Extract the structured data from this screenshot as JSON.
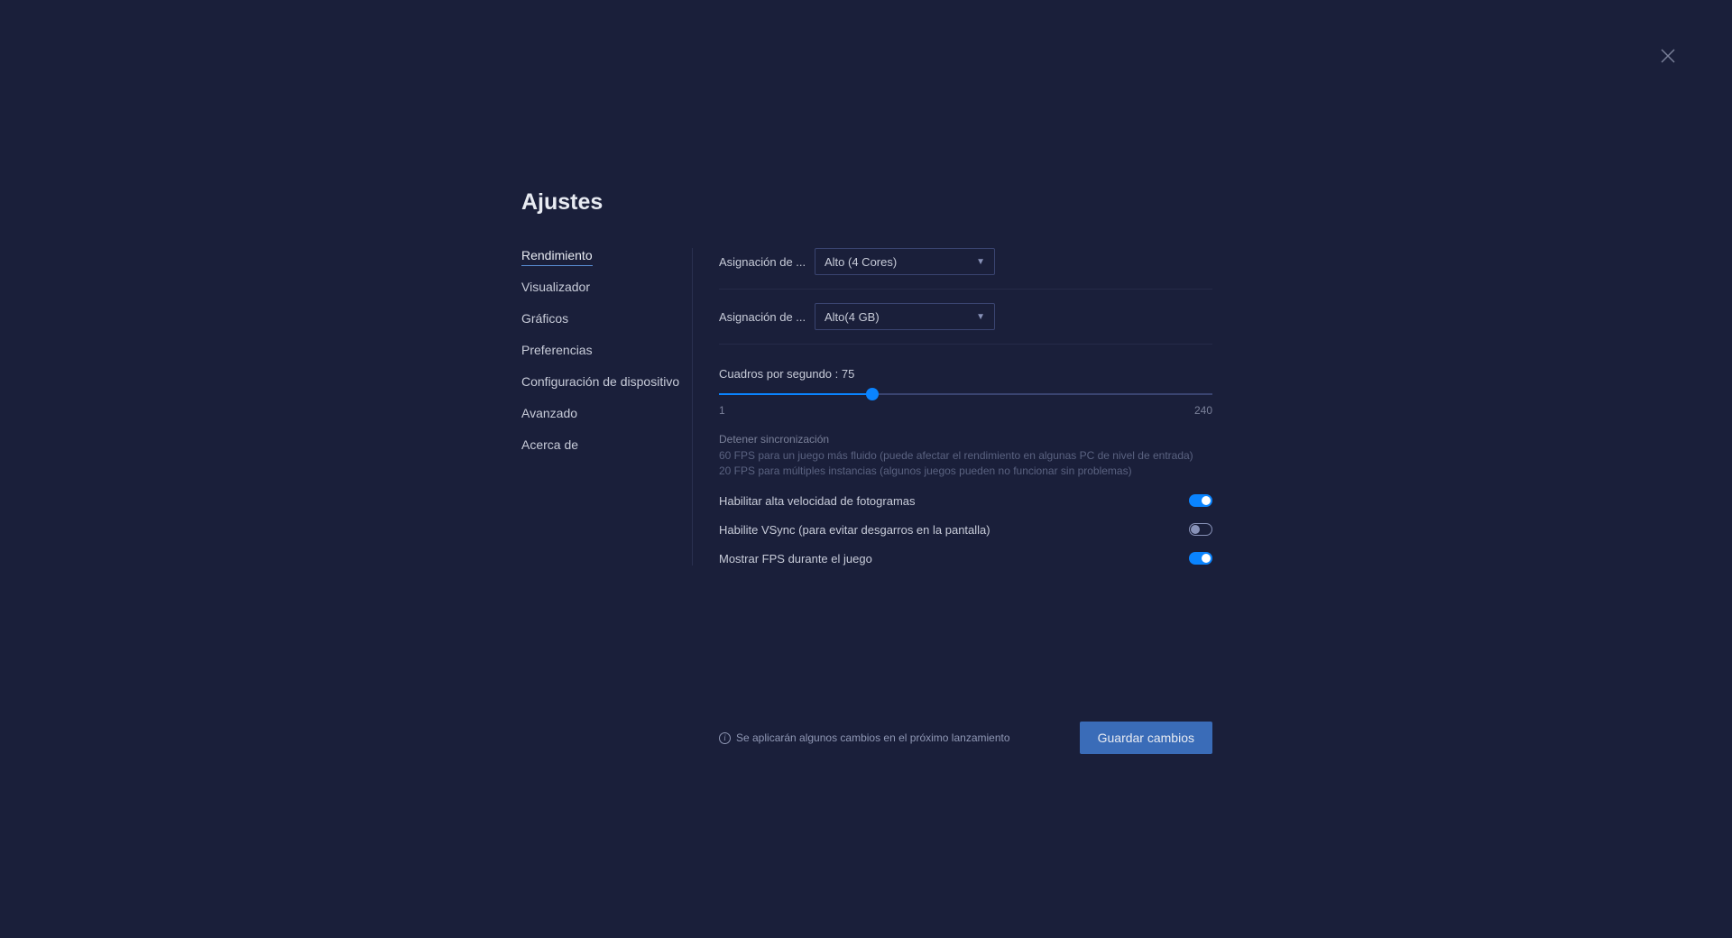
{
  "title": "Ajustes",
  "sidebar": {
    "items": [
      {
        "label": "Rendimiento",
        "active": true
      },
      {
        "label": "Visualizador",
        "active": false
      },
      {
        "label": "Gráficos",
        "active": false
      },
      {
        "label": "Preferencias",
        "active": false
      },
      {
        "label": "Configuración de dispositivo",
        "active": false
      },
      {
        "label": "Avanzado",
        "active": false
      },
      {
        "label": "Acerca de",
        "active": false
      }
    ]
  },
  "settings": {
    "cpu_label": "Asignación de ...",
    "cpu_value": "Alto (4 Cores)",
    "ram_label": "Asignación de ...",
    "ram_value": "Alto(4 GB)",
    "fps": {
      "label_prefix": "Cuadros por segundo : ",
      "value": "75",
      "min": "1",
      "max": "240",
      "percent": 31
    },
    "sync_info": {
      "title": "Detener sincronización",
      "line1": "60 FPS para un juego más fluido (puede afectar el rendimiento en algunas PC de nivel de entrada)",
      "line2": "20 FPS para múltiples instancias (algunos juegos pueden no funcionar sin problemas)"
    },
    "toggles": {
      "high_fps": {
        "label": "Habilitar alta velocidad de fotogramas",
        "on": true
      },
      "vsync": {
        "label": "Habilite VSync (para evitar desgarros en la pantalla)",
        "on": false
      },
      "show_fps": {
        "label": "Mostrar FPS durante el juego",
        "on": true
      }
    }
  },
  "footer": {
    "notice": "Se aplicarán algunos cambios en el próximo lanzamiento",
    "save_label": "Guardar cambios"
  }
}
